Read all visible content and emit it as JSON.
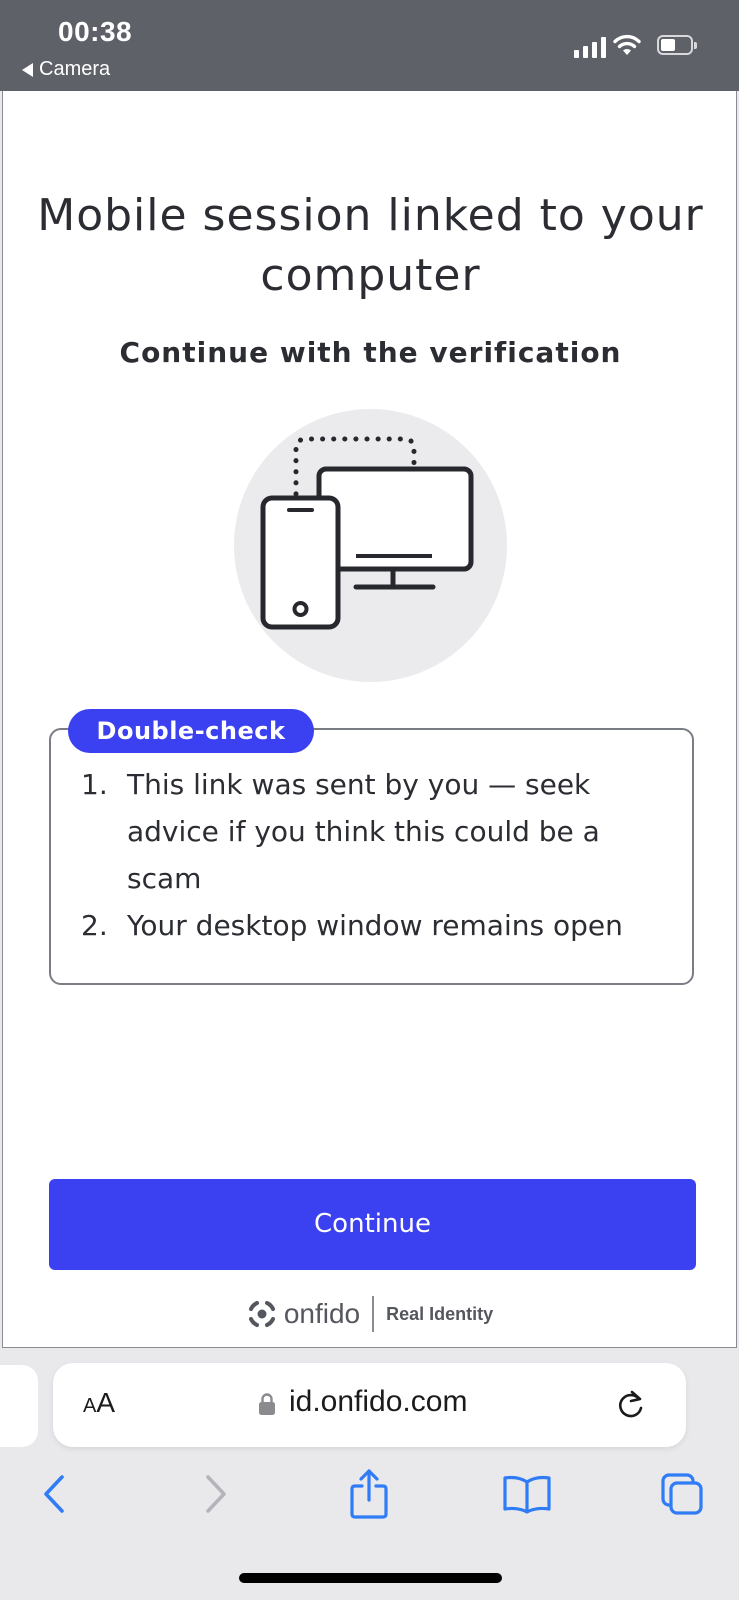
{
  "status_bar": {
    "time": "00:38",
    "back_app": "Camera"
  },
  "page": {
    "title": "Mobile session linked to your computer",
    "subtitle": "Continue with the verification",
    "double_check": {
      "badge": "Double-check",
      "items": [
        {
          "number": "1.",
          "text": "This link was sent by you — seek advice if you think this could be a scam"
        },
        {
          "number": "2.",
          "text": "Your desktop window remains open"
        }
      ]
    },
    "continue_label": "Continue",
    "footer": {
      "brand": "onfido",
      "tagline": "Real Identity"
    }
  },
  "browser": {
    "text_size_small": "A",
    "text_size_big": "A",
    "url": "id.onfido.com",
    "toolbar_icons": [
      "back-icon",
      "forward-icon",
      "share-icon",
      "bookmarks-icon",
      "tabs-icon"
    ]
  },
  "colors": {
    "accent": "#3b41f0",
    "status_bar": "#5f6169",
    "ios_blue": "#2f7cf6"
  }
}
